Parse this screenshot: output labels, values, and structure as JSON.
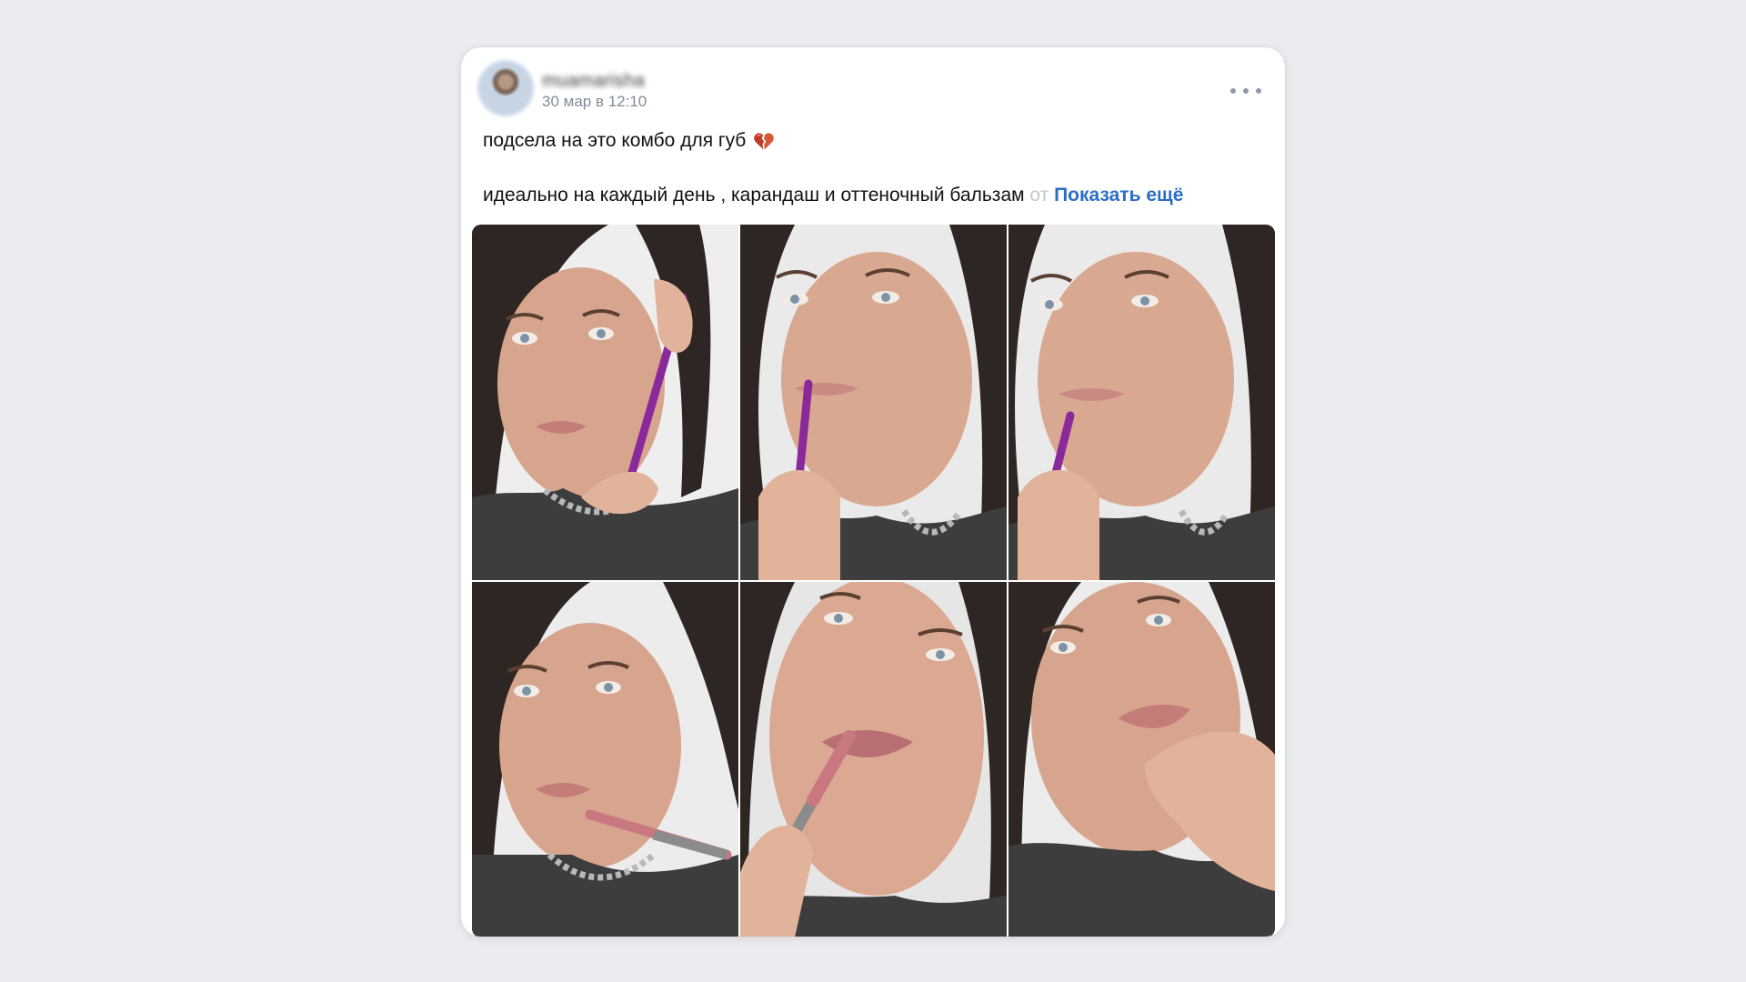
{
  "post": {
    "author": "muamarisha",
    "date": "30 мар в 12:10",
    "line1": "подсела на это комбо для губ",
    "line2": "идеально на каждый день , карандаш и оттеночный бальзам",
    "line2_fade": " от",
    "show_more": "Показать ещё",
    "heart_icon": "broken-heart-icon",
    "more_icon": "more-horizontal-icon"
  },
  "photos": [
    {
      "id": "1",
      "desc_icon": "photo"
    },
    {
      "id": "2",
      "desc_icon": "photo"
    },
    {
      "id": "3",
      "desc_icon": "photo"
    },
    {
      "id": "4",
      "desc_icon": "photo"
    },
    {
      "id": "5",
      "desc_icon": "photo"
    },
    {
      "id": "6",
      "desc_icon": "photo"
    }
  ],
  "colors": {
    "page_bg": "#ebecf0",
    "card_bg": "#ffffff",
    "link": "#2a6ec3",
    "meta": "#818c99",
    "lip_pencil": "#8a2a9a",
    "lip_tint": "#c97882"
  }
}
